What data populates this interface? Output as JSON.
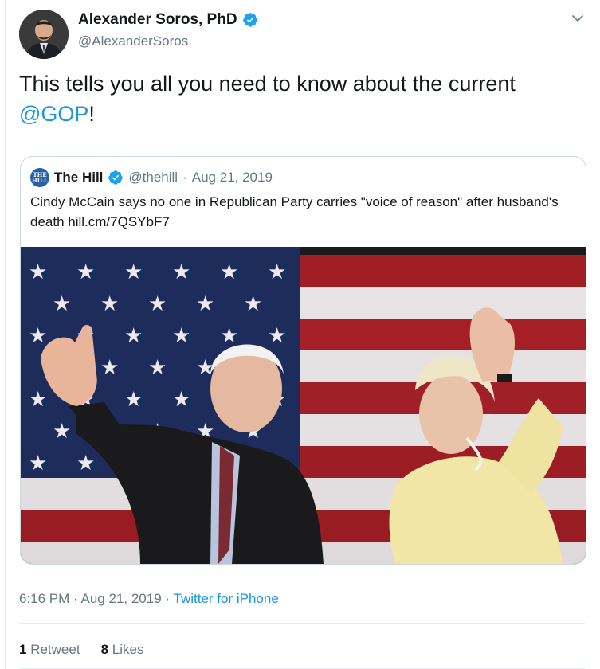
{
  "author": {
    "name": "Alexander Soros, PhD",
    "handle": "@AlexanderSoros",
    "verified": true
  },
  "tweet": {
    "text_before": "This tells you all you need to know about the current ",
    "mention": "@GOP",
    "text_after": "!"
  },
  "quote": {
    "logo_text": "THE HILL",
    "name": "The Hill",
    "handle": "@thehill",
    "separator": "·",
    "date": "Aug 21, 2019",
    "text": "Cindy McCain says no one in Republican Party carries \"voice of reason\" after husband's death hill.cm/7QSYbF7"
  },
  "meta": {
    "time": "6:16 PM",
    "separator": "·",
    "date": "Aug 21, 2019",
    "separator2": "·",
    "source": "Twitter for iPhone"
  },
  "stats": {
    "retweets_count": "1",
    "retweets_label": "Retweet",
    "likes_count": "8",
    "likes_label": "Likes"
  },
  "colors": {
    "accent": "#1b95e0",
    "text": "#14171a",
    "muted": "#657786",
    "border": "#ccd6dd"
  },
  "icons": {
    "verified": "verified-badge-icon",
    "chevron": "chevron-down-icon"
  }
}
